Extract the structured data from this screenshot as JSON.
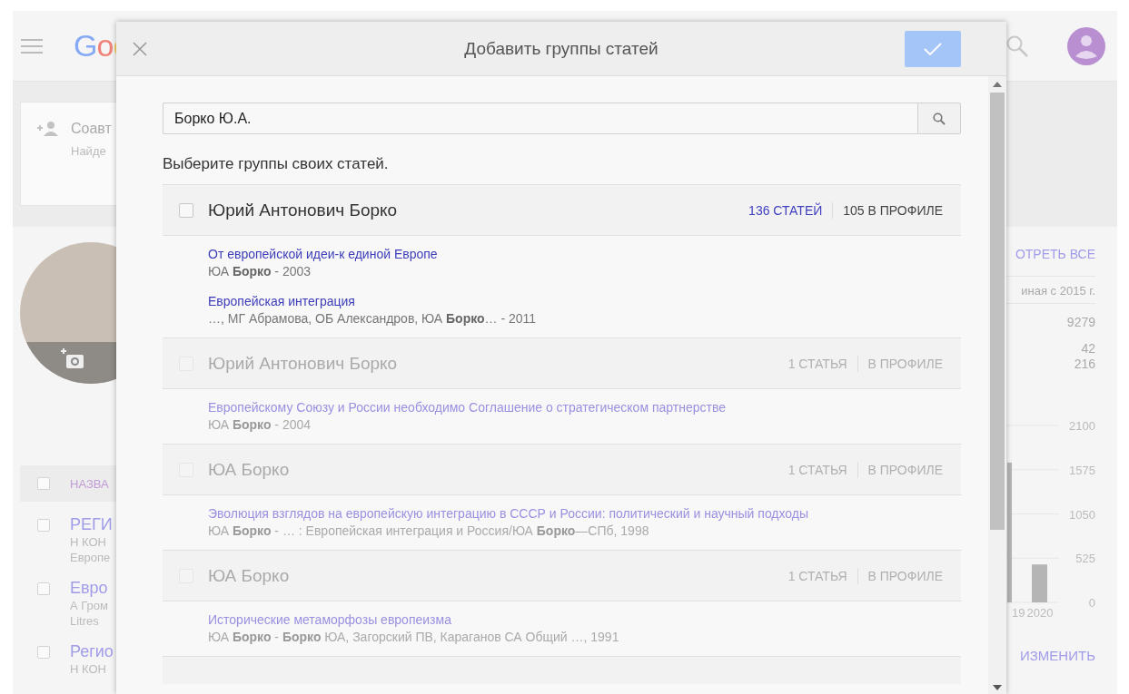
{
  "page": {
    "logo": "Goo",
    "coauthors": {
      "title": "Соавт",
      "hint": "Найде"
    },
    "articles_header": {
      "label": "НАЗВА",
      "checked": false
    },
    "articles": [
      {
        "title": "РЕГИ",
        "lines": [
          "Н КОН",
          "Европе"
        ],
        "checked": false
      },
      {
        "title": "Евро",
        "lines": [
          "А Гром",
          "Litres"
        ],
        "checked": false
      },
      {
        "title": "Регио",
        "lines": [
          "Н КОН"
        ],
        "checked": false
      }
    ],
    "view_all": "ОТРЕТЬ ВСЕ",
    "stats_column": "иная с 2015 г.",
    "stats": [
      [
        "9279"
      ],
      [
        "42",
        "216"
      ]
    ],
    "chart_data": {
      "type": "bar",
      "categories": [
        "19",
        "2020"
      ],
      "values": [
        1660,
        450
      ],
      "yticks": [
        0,
        525,
        1050,
        1575,
        2100
      ],
      "ylim": [
        0,
        2100
      ],
      "grid": true
    },
    "edit": "ИЗМЕНИТЬ"
  },
  "dialog": {
    "title": "Добавить группы статей",
    "confirm_disabled": true,
    "search": {
      "value": "Борко Ю.А."
    },
    "prompt": "Выберите группы своих статей.",
    "groups": [
      {
        "name": "Юрий Антонович Борко",
        "count": "136 СТАТЕЙ",
        "in_profile": "105 В ПРОФИЛЕ",
        "checked": false,
        "disabled": false,
        "articles": [
          {
            "title": "От европейской идеи-к единой Европе",
            "meta": "ЮА **Борко** - 2003"
          },
          {
            "title": "Европейская интеграция",
            "meta": "…, МГ Абрамова, ОБ Александров, ЮА **Борко**… - 2011"
          }
        ]
      },
      {
        "name": "Юрий Антонович Борко",
        "count": "1 СТАТЬЯ",
        "in_profile": "В ПРОФИЛЕ",
        "checked": false,
        "disabled": true,
        "articles": [
          {
            "title": "Европейскому Союзу и России необходимо Соглашение о стратегическом партнерстве",
            "meta": "ЮА **Борко** - 2004"
          }
        ]
      },
      {
        "name": "ЮА Борко",
        "count": "1 СТАТЬЯ",
        "in_profile": "В ПРОФИЛЕ",
        "checked": false,
        "disabled": true,
        "articles": [
          {
            "title": "Эволюция взглядов на европейскую интеграцию в СССР и России: политический и научный подходы",
            "meta": "ЮА **Борко** - … : Европейская интеграция и Россия/ЮА **Борко**—СПб, 1998"
          }
        ]
      },
      {
        "name": "ЮА Борко",
        "count": "1 СТАТЬЯ",
        "in_profile": "В ПРОФИЛЕ",
        "checked": false,
        "disabled": true,
        "articles": [
          {
            "title": "Исторические метаморфозы европеизма",
            "meta": "ЮА **Борко** - **Борко** ЮА, Загорский ПВ, Караганов СА Общий …, 1991"
          }
        ]
      }
    ]
  }
}
